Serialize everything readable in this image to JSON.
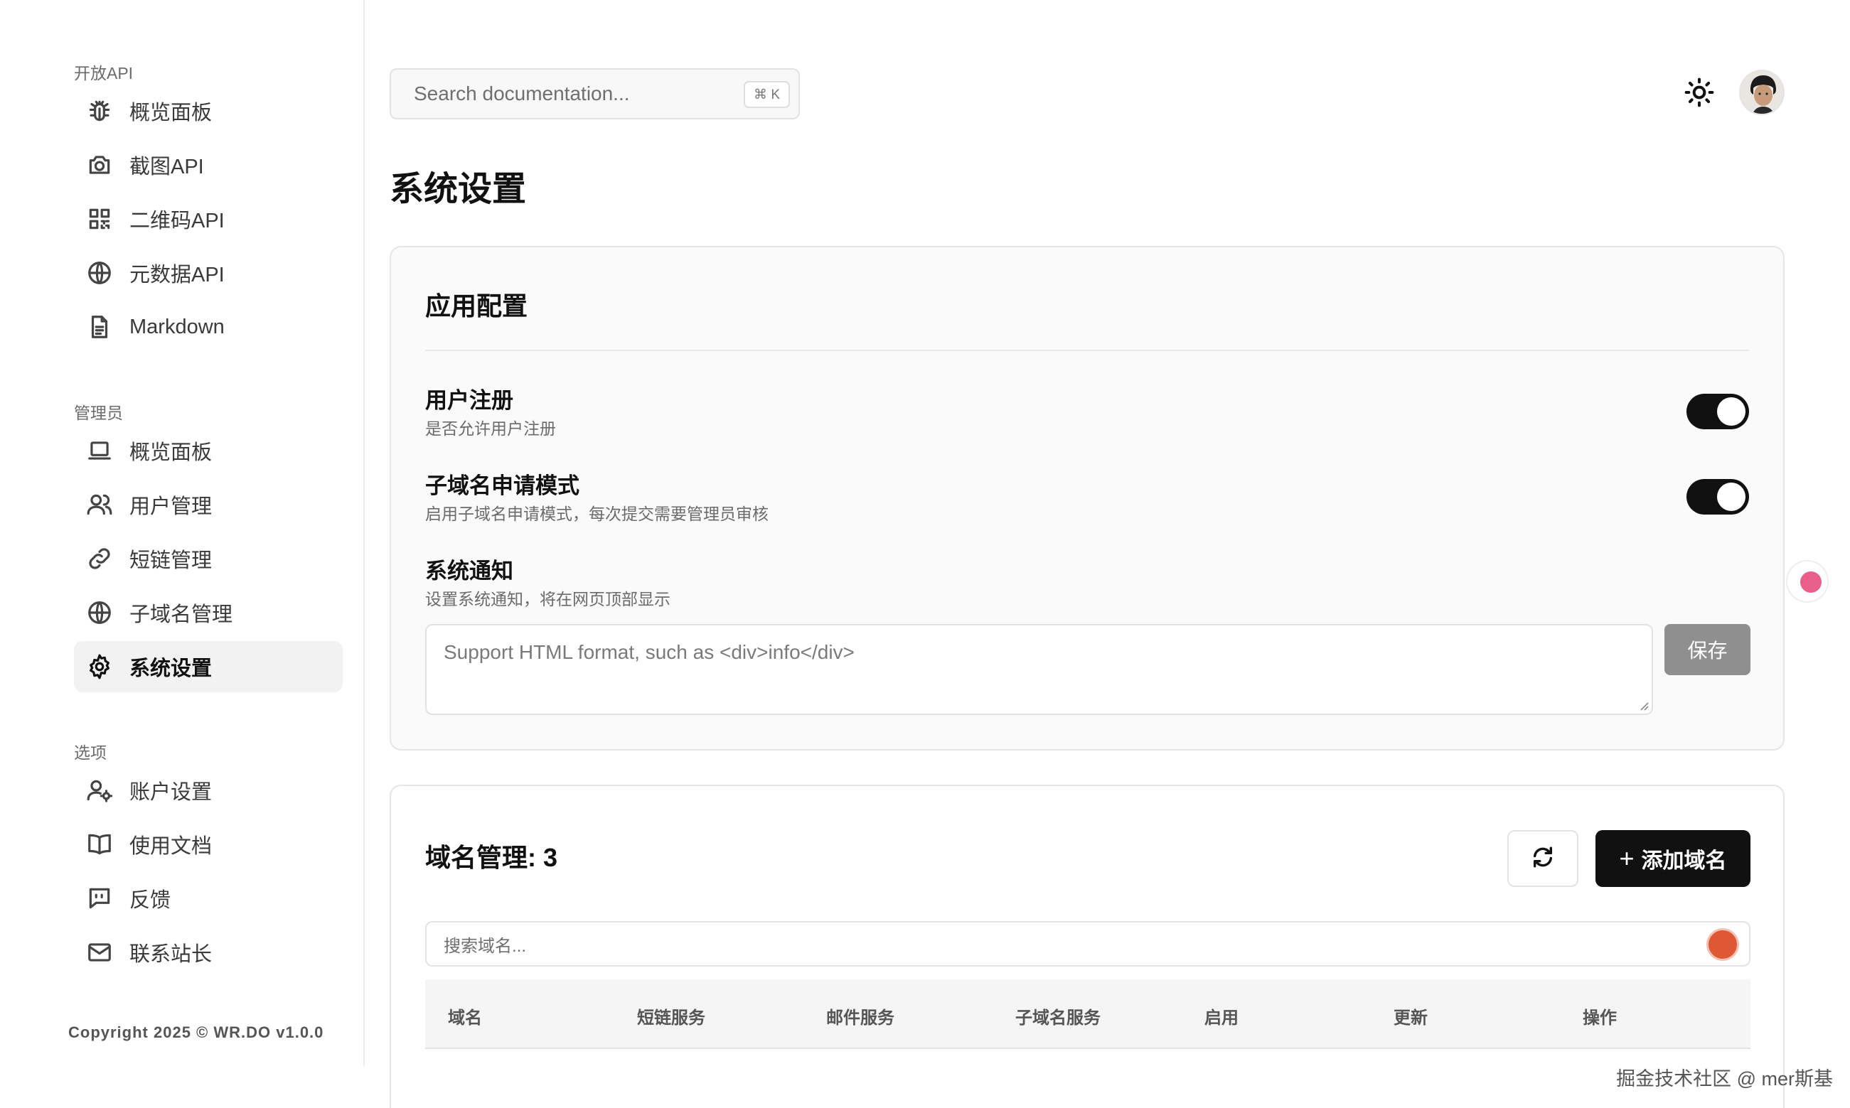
{
  "sidebar": {
    "sections": [
      {
        "title": "开放API",
        "items": [
          {
            "label": "概览面板",
            "icon": "bug-icon"
          },
          {
            "label": "截图API",
            "icon": "camera-icon"
          },
          {
            "label": "二维码API",
            "icon": "qrcode-icon"
          },
          {
            "label": "元数据API",
            "icon": "globe-icon"
          },
          {
            "label": "Markdown",
            "icon": "document-icon"
          }
        ]
      },
      {
        "title": "管理员",
        "items": [
          {
            "label": "概览面板",
            "icon": "laptop-icon"
          },
          {
            "label": "用户管理",
            "icon": "users-icon"
          },
          {
            "label": "短链管理",
            "icon": "link-icon"
          },
          {
            "label": "子域名管理",
            "icon": "globe-icon"
          },
          {
            "label": "系统设置",
            "icon": "gear-icon",
            "active": true
          }
        ]
      },
      {
        "title": "选项",
        "items": [
          {
            "label": "账户设置",
            "icon": "user-cog-icon"
          },
          {
            "label": "使用文档",
            "icon": "book-icon"
          },
          {
            "label": "反馈",
            "icon": "message-icon"
          },
          {
            "label": "联系站长",
            "icon": "mail-icon"
          }
        ]
      }
    ],
    "copyright": "Copyright 2025 © WR.DO v1.0.0"
  },
  "header": {
    "search_placeholder": "Search documentation...",
    "search_shortcut": "⌘ K"
  },
  "page": {
    "title": "系统设置"
  },
  "app_config": {
    "title": "应用配置",
    "user_registration": {
      "title": "用户注册",
      "desc": "是否允许用户注册",
      "enabled": true
    },
    "subdomain_mode": {
      "title": "子域名申请模式",
      "desc": "启用子域名申请模式，每次提交需要管理员审核",
      "enabled": true
    },
    "system_notice": {
      "title": "系统通知",
      "desc": "设置系统通知，将在网页顶部显示",
      "placeholder": "Support HTML format, such as <div>info</div>",
      "value": "",
      "save_label": "保存"
    }
  },
  "domain_management": {
    "title": "域名管理: 3",
    "add_label": "添加域名",
    "search_placeholder": "搜索域名...",
    "columns": [
      "域名",
      "短链服务",
      "邮件服务",
      "子域名服务",
      "启用",
      "更新",
      "操作"
    ]
  },
  "watermark": "掘金技术社区 @ mer斯基",
  "colors": {
    "primary": "#111111",
    "save_disabled": "#8f8f8f",
    "muted_text": "#6b6b6b"
  }
}
